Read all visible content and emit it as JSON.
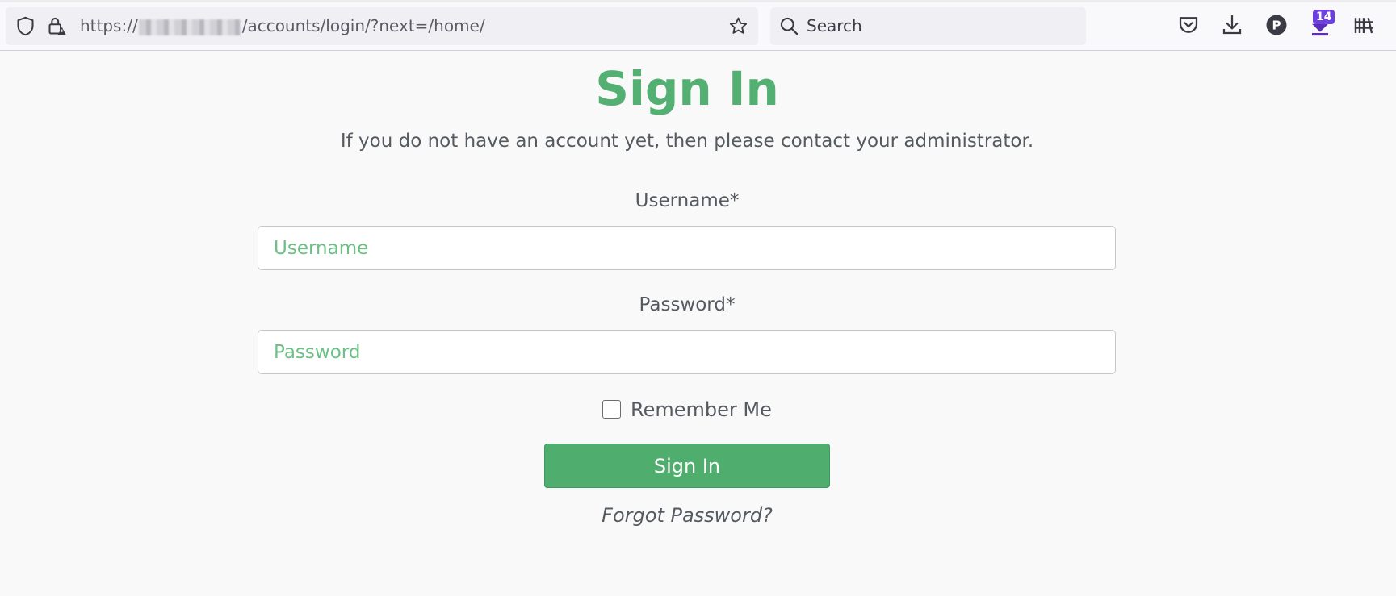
{
  "browser": {
    "url_prefix": "https://",
    "url_path": "/accounts/login/?next=/home/",
    "search_placeholder": "Search",
    "extension_badge": "14"
  },
  "login": {
    "title": "Sign In",
    "subtitle": "If you do not have an account yet, then please contact your administrator.",
    "username_label": "Username*",
    "username_placeholder": "Username",
    "username_value": "",
    "password_label": "Password*",
    "password_placeholder": "Password",
    "password_value": "",
    "remember_label": "Remember Me",
    "remember_checked": false,
    "submit_label": "Sign In",
    "forgot_label": "Forgot Password?"
  },
  "colors": {
    "accent": "#4fae6e",
    "title": "#53b072",
    "placeholder": "#6cc085",
    "text": "#555a60",
    "badge": "#6e3fe0"
  },
  "icons": {
    "urlbar": [
      "shield-icon",
      "lock-warning-icon",
      "star-icon"
    ],
    "search": "search-icon",
    "toolbar": [
      "pocket-icon",
      "download-icon",
      "profile-p-icon",
      "extension-download-icon",
      "library-icon"
    ]
  }
}
